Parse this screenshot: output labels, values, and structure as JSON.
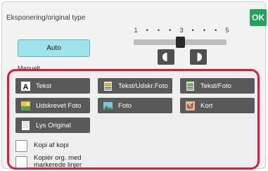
{
  "dialog": {
    "title": "Eksponering/original type",
    "ok_label": "OK"
  },
  "exposure": {
    "scale_labels": [
      "1",
      "•",
      "•",
      "•",
      "3",
      "•",
      "•",
      "•",
      "5"
    ],
    "level": 3,
    "level_min": 1,
    "level_max": 5,
    "auto_label": "Auto",
    "manual_label": "Manuelt"
  },
  "original_types": {
    "buttons": [
      {
        "label": "Tekst",
        "icon": "text-a-icon"
      },
      {
        "label": "Tekst/Udskr.Foto",
        "icon": "text-printed-photo-icon"
      },
      {
        "label": "Tekst/Foto",
        "icon": "text-photo-icon"
      },
      {
        "label": "Udskrevet Foto",
        "icon": "printed-photo-icon"
      },
      {
        "label": "Foto",
        "icon": "photo-icon"
      },
      {
        "label": "Kort",
        "icon": "map-icon"
      },
      {
        "label": "Lys Original",
        "icon": "light-original-icon"
      }
    ],
    "checkboxes": [
      {
        "label": "Kopi af kopi",
        "checked": false
      },
      {
        "label_line1": "Kopiér org. med",
        "label_line2": "markerede linjer",
        "checked": false
      }
    ]
  },
  "colors": {
    "ok": "#1fa45b",
    "auto_selected": "#9fe4ea",
    "panel_highlight": "#d9203a",
    "button": "#595959"
  }
}
